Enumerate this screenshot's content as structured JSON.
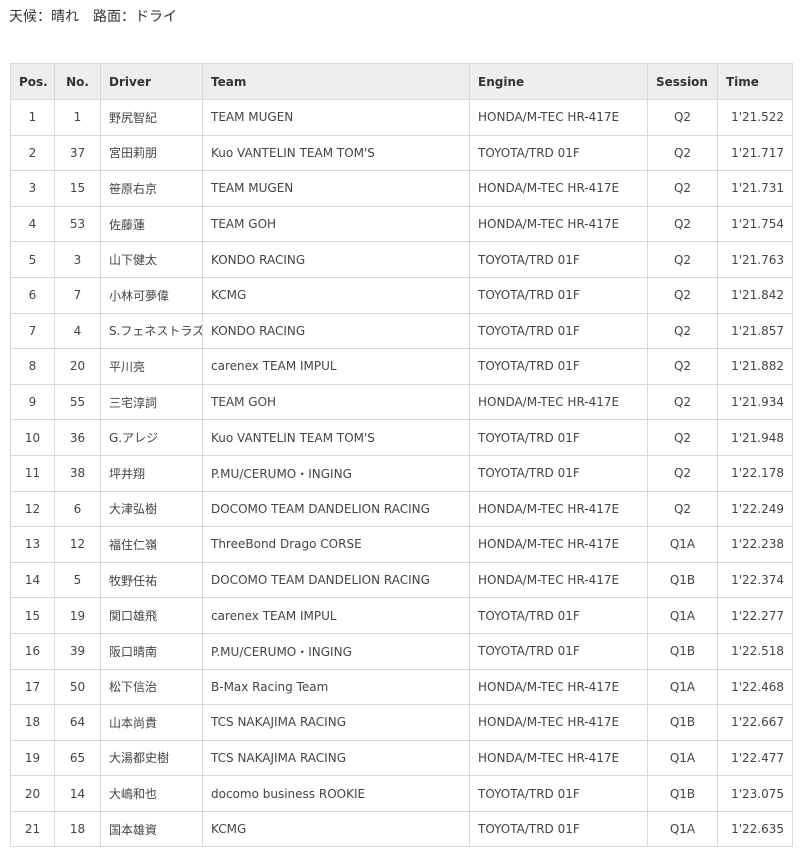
{
  "conditions": "天候：晴れ　路面：ドライ",
  "table": {
    "headers": {
      "pos": "Pos.",
      "no": "No.",
      "driver": "Driver",
      "team": "Team",
      "engine": "Engine",
      "session": "Session",
      "time": "Time"
    },
    "rows": [
      {
        "pos": "1",
        "no": "1",
        "driver": "野尻智紀",
        "team": "TEAM MUGEN",
        "engine": "HONDA/M-TEC HR-417E",
        "session": "Q2",
        "time": "1'21.522"
      },
      {
        "pos": "2",
        "no": "37",
        "driver": "宮田莉朋",
        "team": "Kuo VANTELIN TEAM TOM'S",
        "engine": "TOYOTA/TRD 01F",
        "session": "Q2",
        "time": "1'21.717"
      },
      {
        "pos": "3",
        "no": "15",
        "driver": "笹原右京",
        "team": "TEAM MUGEN",
        "engine": "HONDA/M-TEC HR-417E",
        "session": "Q2",
        "time": "1'21.731"
      },
      {
        "pos": "4",
        "no": "53",
        "driver": "佐藤蓮",
        "team": "TEAM GOH",
        "engine": "HONDA/M-TEC HR-417E",
        "session": "Q2",
        "time": "1'21.754"
      },
      {
        "pos": "5",
        "no": "3",
        "driver": "山下健太",
        "team": "KONDO RACING",
        "engine": "TOYOTA/TRD 01F",
        "session": "Q2",
        "time": "1'21.763"
      },
      {
        "pos": "6",
        "no": "7",
        "driver": "小林可夢偉",
        "team": "KCMG",
        "engine": "TOYOTA/TRD 01F",
        "session": "Q2",
        "time": "1'21.842"
      },
      {
        "pos": "7",
        "no": "4",
        "driver": "S.フェネストラズ",
        "team": "KONDO RACING",
        "engine": "TOYOTA/TRD 01F",
        "session": "Q2",
        "time": "1'21.857"
      },
      {
        "pos": "8",
        "no": "20",
        "driver": "平川亮",
        "team": "carenex TEAM IMPUL",
        "engine": "TOYOTA/TRD 01F",
        "session": "Q2",
        "time": "1'21.882"
      },
      {
        "pos": "9",
        "no": "55",
        "driver": "三宅淳詞",
        "team": "TEAM GOH",
        "engine": "HONDA/M-TEC HR-417E",
        "session": "Q2",
        "time": "1'21.934"
      },
      {
        "pos": "10",
        "no": "36",
        "driver": "G.アレジ",
        "team": "Kuo VANTELIN TEAM TOM'S",
        "engine": "TOYOTA/TRD 01F",
        "session": "Q2",
        "time": "1'21.948"
      },
      {
        "pos": "11",
        "no": "38",
        "driver": "坪井翔",
        "team": "P.MU/CERUMO・INGING",
        "engine": "TOYOTA/TRD 01F",
        "session": "Q2",
        "time": "1'22.178"
      },
      {
        "pos": "12",
        "no": "6",
        "driver": "大津弘樹",
        "team": "DOCOMO TEAM DANDELION RACING",
        "engine": "HONDA/M-TEC HR-417E",
        "session": "Q2",
        "time": "1'22.249"
      },
      {
        "pos": "13",
        "no": "12",
        "driver": "福住仁嶺",
        "team": "ThreeBond Drago CORSE",
        "engine": "HONDA/M-TEC HR-417E",
        "session": "Q1A",
        "time": "1'22.238"
      },
      {
        "pos": "14",
        "no": "5",
        "driver": "牧野任祐",
        "team": "DOCOMO TEAM DANDELION RACING",
        "engine": "HONDA/M-TEC HR-417E",
        "session": "Q1B",
        "time": "1'22.374"
      },
      {
        "pos": "15",
        "no": "19",
        "driver": "関口雄飛",
        "team": "carenex TEAM IMPUL",
        "engine": "TOYOTA/TRD 01F",
        "session": "Q1A",
        "time": "1'22.277"
      },
      {
        "pos": "16",
        "no": "39",
        "driver": "阪口晴南",
        "team": "P.MU/CERUMO・INGING",
        "engine": "TOYOTA/TRD 01F",
        "session": "Q1B",
        "time": "1'22.518"
      },
      {
        "pos": "17",
        "no": "50",
        "driver": "松下信治",
        "team": "B-Max Racing Team",
        "engine": "HONDA/M-TEC HR-417E",
        "session": "Q1A",
        "time": "1'22.468"
      },
      {
        "pos": "18",
        "no": "64",
        "driver": "山本尚貴",
        "team": "TCS NAKAJIMA RACING",
        "engine": "HONDA/M-TEC HR-417E",
        "session": "Q1B",
        "time": "1'22.667"
      },
      {
        "pos": "19",
        "no": "65",
        "driver": "大湯都史樹",
        "team": "TCS NAKAJIMA RACING",
        "engine": "HONDA/M-TEC HR-417E",
        "session": "Q1A",
        "time": "1'22.477"
      },
      {
        "pos": "20",
        "no": "14",
        "driver": "大嶋和也",
        "team": "docomo business ROOKIE",
        "engine": "TOYOTA/TRD 01F",
        "session": "Q1B",
        "time": "1'23.075"
      },
      {
        "pos": "21",
        "no": "18",
        "driver": "国本雄資",
        "team": "KCMG",
        "engine": "TOYOTA/TRD 01F",
        "session": "Q1A",
        "time": "1'22.635"
      }
    ]
  }
}
